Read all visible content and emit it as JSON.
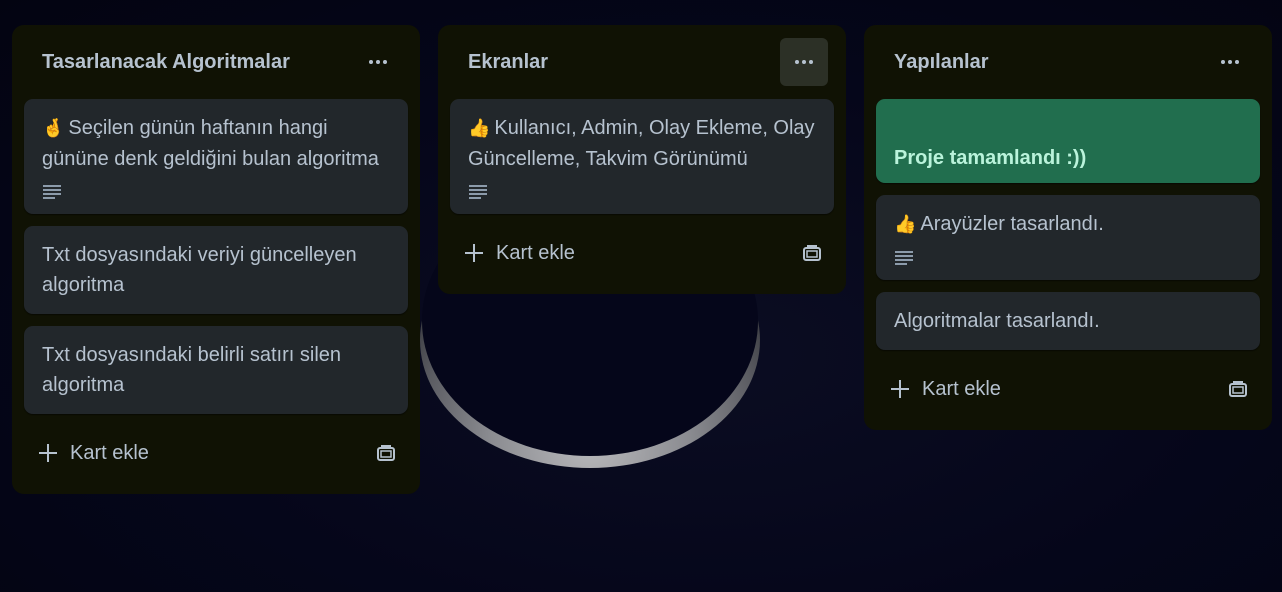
{
  "lists": [
    {
      "title": "Tasarlanacak Algoritmalar",
      "cards": [
        {
          "emoji": "🤞",
          "text": "Seçilen günün haftanın hangi gününe denk geldiğini bulan algoritma",
          "has_description": true
        },
        {
          "text": "Txt dosyasındaki veriyi güncelleyen algoritma"
        },
        {
          "text": "Txt dosyasındaki belirli satırı silen algoritma"
        }
      ],
      "add_label": "Kart ekle"
    },
    {
      "title": "Ekranlar",
      "cards": [
        {
          "emoji": "👍",
          "text": "Kullanıcı, Admin, Olay Ekleme, Olay Güncelleme, Takvim Görünümü",
          "has_description": true
        }
      ],
      "add_label": "Kart ekle"
    },
    {
      "title": "Yapılanlar",
      "cards": [
        {
          "text": "Proje tamamlandı :))",
          "cover_color": "#216e4e"
        },
        {
          "emoji": "👍",
          "text": "Arayüzler tasarlandı.",
          "has_description": true
        },
        {
          "text": "Algoritmalar tasarlandı."
        }
      ],
      "add_label": "Kart ekle"
    }
  ],
  "icons": {
    "menu": "more-horizontal-icon",
    "description": "description-lines-icon",
    "add": "plus-icon",
    "template": "card-template-icon"
  },
  "colors": {
    "list_bg": "#101204",
    "card_bg": "#22272b",
    "text": "#b6c2cf",
    "green_card": "#216e4e"
  }
}
